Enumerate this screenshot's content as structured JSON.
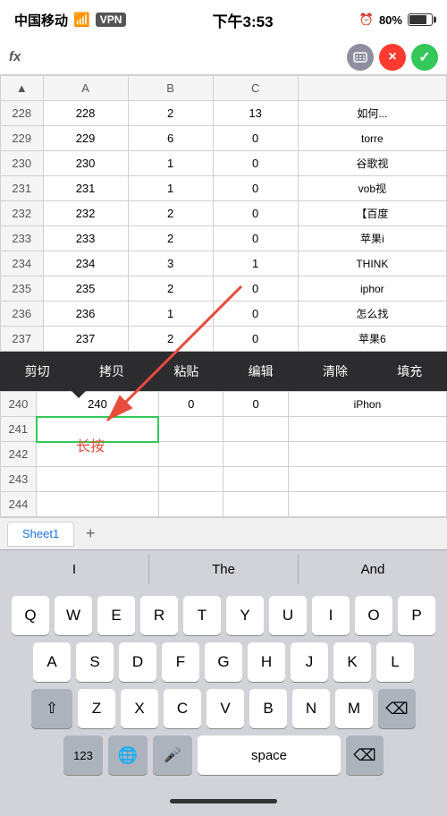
{
  "status": {
    "carrier": "中国移动",
    "wifi": "WiFi",
    "vpn": "VPN",
    "time": "下午3:53",
    "battery": "80%"
  },
  "formula_bar": {
    "fx_label": "fx",
    "cancel_icon": "×",
    "confirm_icon": "✓"
  },
  "columns": {
    "corner": "▲",
    "a": "A",
    "b": "B",
    "c": "C",
    "d": ""
  },
  "rows": [
    {
      "num": "228",
      "a": "228",
      "b": "2",
      "c": "13",
      "d": "如何..."
    },
    {
      "num": "229",
      "a": "229",
      "b": "6",
      "c": "0",
      "d": "torre"
    },
    {
      "num": "230",
      "a": "230",
      "b": "1",
      "c": "0",
      "d": "谷歌视"
    },
    {
      "num": "231",
      "a": "231",
      "b": "1",
      "c": "0",
      "d": "vob视"
    },
    {
      "num": "232",
      "a": "232",
      "b": "2",
      "c": "0",
      "d": "【百度"
    },
    {
      "num": "233",
      "a": "233",
      "b": "2",
      "c": "0",
      "d": "苹果i"
    },
    {
      "num": "234",
      "a": "234",
      "b": "3",
      "c": "1",
      "d": "THINK"
    },
    {
      "num": "235",
      "a": "235",
      "b": "2",
      "c": "0",
      "d": "iphor"
    },
    {
      "num": "236",
      "a": "236",
      "b": "1",
      "c": "0",
      "d": "怎么找"
    },
    {
      "num": "237",
      "a": "237",
      "b": "2",
      "c": "0",
      "d": "苹果6"
    }
  ],
  "context_menu": {
    "cut": "剪切",
    "copy": "拷贝",
    "paste": "粘贴",
    "edit": "编辑",
    "clear": "清除",
    "fill": "填充"
  },
  "extra_rows": [
    {
      "num": "240",
      "a": "240",
      "b": "0",
      "c": "0",
      "d": "iPhon"
    },
    {
      "num": "241",
      "a": "",
      "b": "",
      "c": "",
      "d": ""
    },
    {
      "num": "242",
      "a": "",
      "b": "",
      "c": "",
      "d": ""
    },
    {
      "num": "243",
      "a": "",
      "b": "",
      "c": "",
      "d": ""
    },
    {
      "num": "244",
      "a": "",
      "b": "",
      "c": "",
      "d": ""
    }
  ],
  "long_press_label": "长按",
  "sheet_tabs": {
    "sheet1": "Sheet1",
    "add": "+"
  },
  "predictive": {
    "word1": "I",
    "word2": "The",
    "word3": "And"
  },
  "keyboard": {
    "row1": [
      "Q",
      "W",
      "E",
      "R",
      "T",
      "Y",
      "U",
      "I",
      "O",
      "P"
    ],
    "row2": [
      "A",
      "S",
      "D",
      "F",
      "G",
      "H",
      "J",
      "K",
      "L"
    ],
    "row3": [
      "Z",
      "X",
      "C",
      "V",
      "B",
      "N",
      "M"
    ],
    "numbers": "123",
    "globe": "🌐",
    "mic": "🎤",
    "space": "space",
    "backspace": "⌫"
  }
}
